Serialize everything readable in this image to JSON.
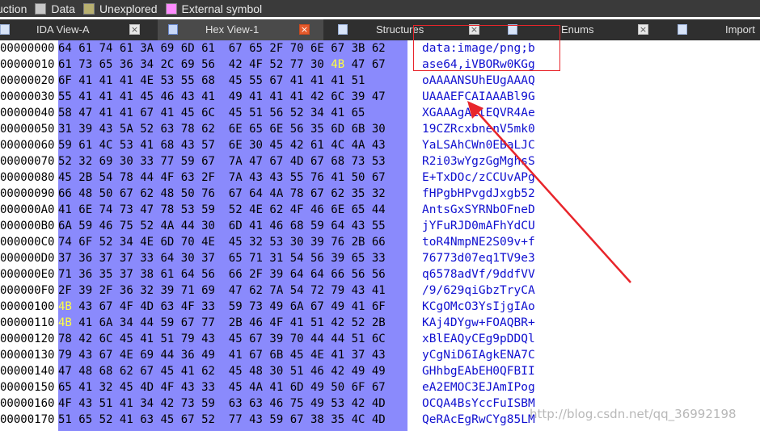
{
  "legend": [
    {
      "label": "uction",
      "color": ""
    },
    {
      "label": "Data",
      "color": "#c8c8c8"
    },
    {
      "label": "Unexplored",
      "color": "#b8b070"
    },
    {
      "label": "External symbol",
      "color": "#ff8cff"
    }
  ],
  "tabs": [
    {
      "label": "IDA View-A",
      "active": false
    },
    {
      "label": "Hex View-1",
      "active": true
    },
    {
      "label": "Structures",
      "active": false
    },
    {
      "label": "Enums",
      "active": false
    },
    {
      "label": "Import",
      "active": false
    }
  ],
  "tab_close_glyph": "×",
  "hex_rows": [
    {
      "addr": "00000000",
      "bytes": [
        "64",
        "61",
        "74",
        "61",
        "3A",
        "69",
        "6D",
        "61",
        "67",
        "65",
        "2F",
        "70",
        "6E",
        "67",
        "3B",
        "62"
      ],
      "ascii": "data:image/png;b"
    },
    {
      "addr": "00000010",
      "bytes": [
        "61",
        "73",
        "65",
        "36",
        "34",
        "2C",
        "69",
        "56",
        "42",
        "4F",
        "52",
        "77",
        "30",
        "4B",
        "47",
        "67"
      ],
      "ascii": "ase64,iVBORw0KGg"
    },
    {
      "addr": "00000020",
      "bytes": [
        "6F",
        "41",
        "41",
        "41",
        "4E",
        "53",
        "55",
        "68",
        "45",
        "55",
        "67",
        "41",
        "41",
        "41",
        "51"
      ],
      "ascii": "oAAAANSUhEUgAAAQ"
    },
    {
      "addr": "00000030",
      "bytes": [
        "55",
        "41",
        "41",
        "41",
        "45",
        "46",
        "43",
        "41",
        "49",
        "41",
        "41",
        "41",
        "42",
        "6C",
        "39",
        "47"
      ],
      "ascii": "UAAAEFCAIAAABl9G"
    },
    {
      "addr": "00000040",
      "bytes": [
        "58",
        "47",
        "41",
        "41",
        "67",
        "41",
        "45",
        "6C",
        "45",
        "51",
        "56",
        "52",
        "34",
        "41",
        "65"
      ],
      "ascii": "XGAAAgAElEQVR4Ae"
    },
    {
      "addr": "00000050",
      "bytes": [
        "31",
        "39",
        "43",
        "5A",
        "52",
        "63",
        "78",
        "62",
        "6E",
        "65",
        "6E",
        "56",
        "35",
        "6D",
        "6B",
        "30"
      ],
      "ascii": "19CZRcxbnenV5mk0"
    },
    {
      "addr": "00000060",
      "bytes": [
        "59",
        "61",
        "4C",
        "53",
        "41",
        "68",
        "43",
        "57",
        "6E",
        "30",
        "45",
        "42",
        "61",
        "4C",
        "4A",
        "43"
      ],
      "ascii": "YaLSAhCWn0EBaLJC"
    },
    {
      "addr": "00000070",
      "bytes": [
        "52",
        "32",
        "69",
        "30",
        "33",
        "77",
        "59",
        "67",
        "7A",
        "47",
        "67",
        "4D",
        "67",
        "68",
        "73",
        "53"
      ],
      "ascii": "R2i03wYgzGgMghsS"
    },
    {
      "addr": "00000080",
      "bytes": [
        "45",
        "2B",
        "54",
        "78",
        "44",
        "4F",
        "63",
        "2F",
        "7A",
        "43",
        "43",
        "55",
        "76",
        "41",
        "50",
        "67"
      ],
      "ascii": "E+TxDOc/zCCUvAPg"
    },
    {
      "addr": "00000090",
      "bytes": [
        "66",
        "48",
        "50",
        "67",
        "62",
        "48",
        "50",
        "76",
        "67",
        "64",
        "4A",
        "78",
        "67",
        "62",
        "35",
        "32"
      ],
      "ascii": "fHPgbHPvgdJxgb52"
    },
    {
      "addr": "000000A0",
      "bytes": [
        "41",
        "6E",
        "74",
        "73",
        "47",
        "78",
        "53",
        "59",
        "52",
        "4E",
        "62",
        "4F",
        "46",
        "6E",
        "65",
        "44"
      ],
      "ascii": "AntsGxSYRNbOFneD"
    },
    {
      "addr": "000000B0",
      "bytes": [
        "6A",
        "59",
        "46",
        "75",
        "52",
        "4A",
        "44",
        "30",
        "6D",
        "41",
        "46",
        "68",
        "59",
        "64",
        "43",
        "55"
      ],
      "ascii": "jYFuRJD0mAFhYdCU"
    },
    {
      "addr": "000000C0",
      "bytes": [
        "74",
        "6F",
        "52",
        "34",
        "4E",
        "6D",
        "70",
        "4E",
        "45",
        "32",
        "53",
        "30",
        "39",
        "76",
        "2B",
        "66"
      ],
      "ascii": "toR4NmpNE2S09v+f"
    },
    {
      "addr": "000000D0",
      "bytes": [
        "37",
        "36",
        "37",
        "37",
        "33",
        "64",
        "30",
        "37",
        "65",
        "71",
        "31",
        "54",
        "56",
        "39",
        "65",
        "33"
      ],
      "ascii": "76773d07eq1TV9e3"
    },
    {
      "addr": "000000E0",
      "bytes": [
        "71",
        "36",
        "35",
        "37",
        "38",
        "61",
        "64",
        "56",
        "66",
        "2F",
        "39",
        "64",
        "64",
        "66",
        "56",
        "56"
      ],
      "ascii": "q6578adVf/9ddfVV"
    },
    {
      "addr": "000000F0",
      "bytes": [
        "2F",
        "39",
        "2F",
        "36",
        "32",
        "39",
        "71",
        "69",
        "47",
        "62",
        "7A",
        "54",
        "72",
        "79",
        "43",
        "41"
      ],
      "ascii": "/9/629qiGbzTryCA"
    },
    {
      "addr": "00000100",
      "bytes": [
        "4B",
        "43",
        "67",
        "4F",
        "4D",
        "63",
        "4F",
        "33",
        "59",
        "73",
        "49",
        "6A",
        "67",
        "49",
        "41",
        "6F"
      ],
      "ascii": "KCgOMcO3YsIjgIAo"
    },
    {
      "addr": "00000110",
      "bytes": [
        "4B",
        "41",
        "6A",
        "34",
        "44",
        "59",
        "67",
        "77",
        "2B",
        "46",
        "4F",
        "41",
        "51",
        "42",
        "52",
        "2B"
      ],
      "ascii": "KAj4DYgw+FOAQBR+"
    },
    {
      "addr": "00000120",
      "bytes": [
        "78",
        "42",
        "6C",
        "45",
        "41",
        "51",
        "79",
        "43",
        "45",
        "67",
        "39",
        "70",
        "44",
        "44",
        "51",
        "6C"
      ],
      "ascii": "xBlEAQyCEg9pDDQl"
    },
    {
      "addr": "00000130",
      "bytes": [
        "79",
        "43",
        "67",
        "4E",
        "69",
        "44",
        "36",
        "49",
        "41",
        "67",
        "6B",
        "45",
        "4E",
        "41",
        "37",
        "43"
      ],
      "ascii": "yCgNiD6IAgkENA7C"
    },
    {
      "addr": "00000140",
      "bytes": [
        "47",
        "48",
        "68",
        "62",
        "67",
        "45",
        "41",
        "62",
        "45",
        "48",
        "30",
        "51",
        "46",
        "42",
        "49",
        "49"
      ],
      "ascii": "GHhbgEAbEH0QFBII"
    },
    {
      "addr": "00000150",
      "bytes": [
        "65",
        "41",
        "32",
        "45",
        "4D",
        "4F",
        "43",
        "33",
        "45",
        "4A",
        "41",
        "6D",
        "49",
        "50",
        "6F",
        "67"
      ],
      "ascii": "eA2EMOC3EJAmIPog"
    },
    {
      "addr": "00000160",
      "bytes": [
        "4F",
        "43",
        "51",
        "41",
        "34",
        "42",
        "73",
        "59",
        "63",
        "63",
        "46",
        "75",
        "49",
        "53",
        "42",
        "4D"
      ],
      "ascii": "OCQA4BsYccFuISBM"
    },
    {
      "addr": "00000170",
      "bytes": [
        "51",
        "65",
        "52",
        "41",
        "63",
        "45",
        "67",
        "52",
        "77",
        "43",
        "59",
        "67",
        "38",
        "35",
        "4C",
        "4D"
      ],
      "ascii": "QeRAcEgRwCYg85LM"
    }
  ],
  "highlight_byte": "4B",
  "colors": {
    "hex_background": "#8a8afc",
    "highlight_byte": "#ffff40",
    "ascii_text": "#1010d0",
    "annotation": "#e8252b",
    "active_tab_close": "#e65a2c"
  },
  "watermark": "http://blog.csdn.net/qq_36992198"
}
